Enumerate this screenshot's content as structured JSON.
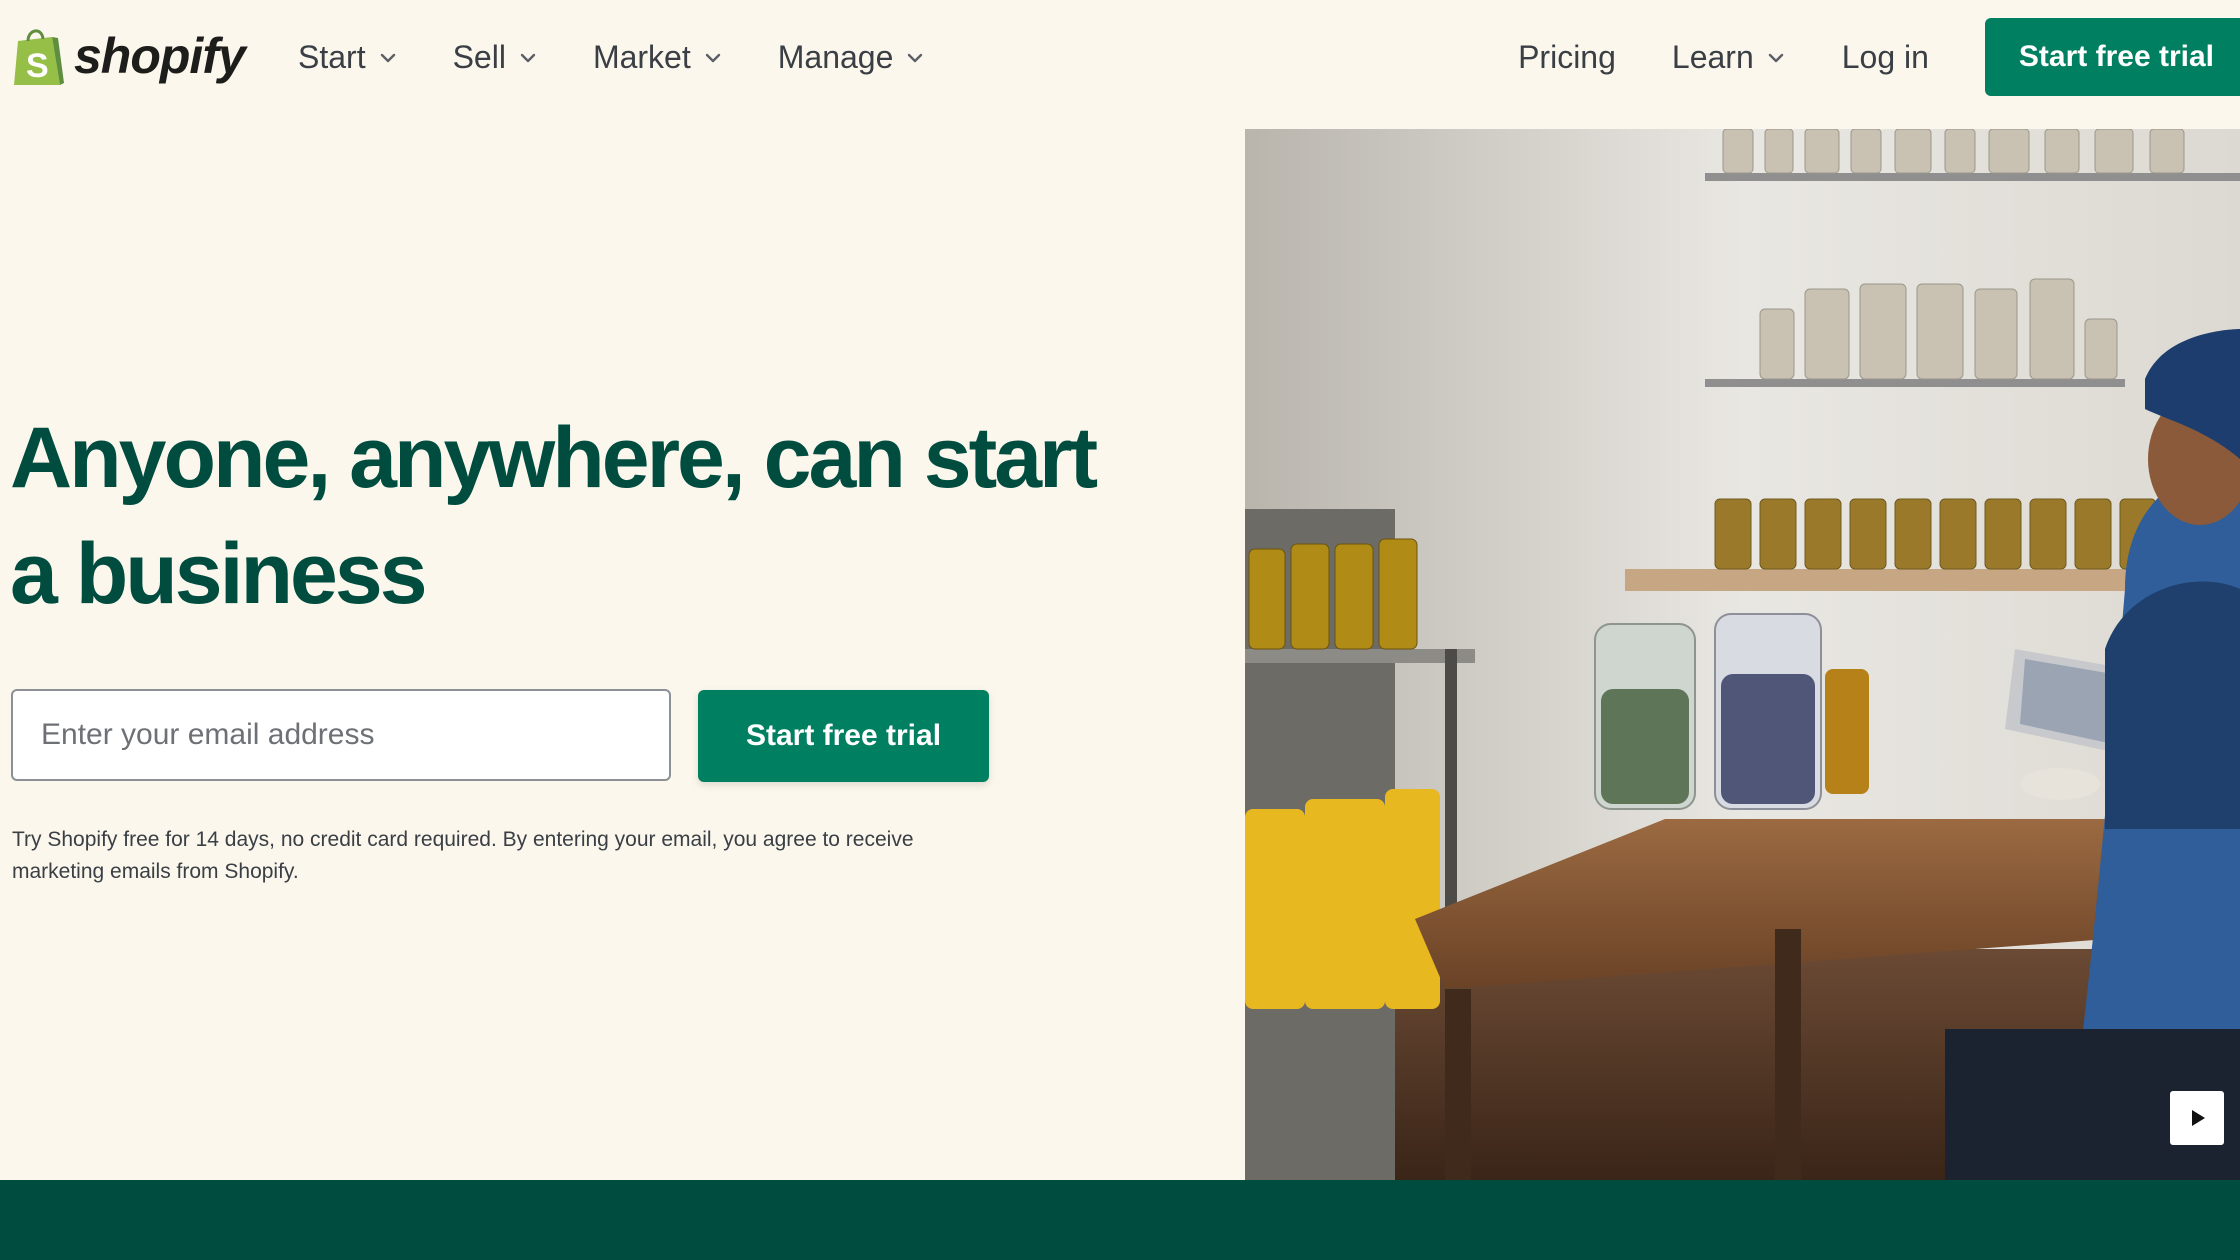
{
  "brand": {
    "name": "shopify",
    "logo_icon": "shopping-bag-icon",
    "colors": {
      "primary_green": "#008060",
      "dark_green": "#004c3f",
      "logo_green": "#95bf47",
      "background": "#fbf7ed"
    }
  },
  "nav": {
    "left_items": [
      {
        "label": "Start",
        "has_dropdown": true
      },
      {
        "label": "Sell",
        "has_dropdown": true
      },
      {
        "label": "Market",
        "has_dropdown": true
      },
      {
        "label": "Manage",
        "has_dropdown": true
      }
    ],
    "pricing_label": "Pricing",
    "learn_label": "Learn",
    "login_label": "Log in",
    "cta_label": "Start free trial"
  },
  "hero": {
    "title": "Anyone, anywhere, can start a business",
    "email_placeholder": "Enter your email address",
    "email_value": "",
    "cta_label": "Start free trial",
    "disclaimer_line1": "Try Shopify free for 14 days, no credit card required. By entering your email, you agree to receive",
    "disclaimer_line2": "marketing emails from Shopify."
  },
  "media": {
    "play_icon": "play-icon"
  }
}
